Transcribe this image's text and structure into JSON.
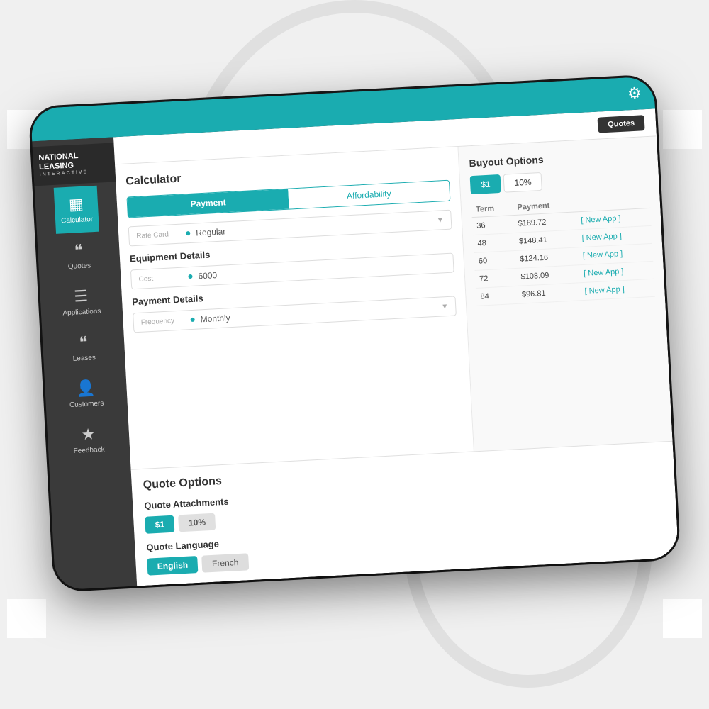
{
  "app": {
    "name": "National Leasing",
    "subtitle": "Interactive"
  },
  "topbar": {
    "settings_icon": "⚙"
  },
  "header": {
    "quotes_button": "Quotes"
  },
  "sidebar": {
    "items": [
      {
        "id": "calculator",
        "label": "Calculator",
        "icon": "▦",
        "active": true
      },
      {
        "id": "quotes",
        "label": "Quotes",
        "icon": "❝",
        "active": false
      },
      {
        "id": "applications",
        "label": "Applications",
        "icon": "☰",
        "active": false
      },
      {
        "id": "leases",
        "label": "Leases",
        "icon": "❝",
        "active": false
      },
      {
        "id": "customers",
        "label": "Customers",
        "icon": "👤",
        "active": false
      },
      {
        "id": "feedback",
        "label": "Feedback",
        "icon": "★",
        "active": false
      }
    ]
  },
  "calculator": {
    "title": "Calculator",
    "tabs": [
      {
        "id": "payment",
        "label": "Payment",
        "active": true
      },
      {
        "id": "affordability",
        "label": "Affordability",
        "active": false
      }
    ],
    "rate_card": {
      "label": "Rate Card",
      "value": "Regular"
    },
    "equipment": {
      "title": "Equipment Details",
      "cost_label": "Cost",
      "cost_value": "6000"
    },
    "payment_details": {
      "title": "Payment Details",
      "frequency_label": "Frequency",
      "frequency_value": "Monthly"
    }
  },
  "buyout_options": {
    "title": "Buyout Options",
    "tabs": [
      {
        "label": "$1",
        "active": true
      },
      {
        "label": "10%",
        "active": false
      }
    ],
    "columns": [
      "Term",
      "Payment",
      ""
    ],
    "rows": [
      {
        "term": "36",
        "payment": "$189.72",
        "action": "[ New App ]"
      },
      {
        "term": "48",
        "payment": "$148.41",
        "action": "[ New App ]"
      },
      {
        "term": "60",
        "payment": "$124.16",
        "action": "[ New App ]"
      },
      {
        "term": "72",
        "payment": "$108.09",
        "action": "[ New App ]"
      },
      {
        "term": "84",
        "payment": "$96.81",
        "action": "[ New App ]"
      }
    ]
  },
  "quote_options": {
    "title": "Quote Options",
    "attachments_title": "Quote Attachments",
    "attachments": [
      {
        "label": "$1",
        "active": true
      },
      {
        "label": "10%",
        "active": false
      }
    ],
    "language_title": "Quote Language",
    "languages": [
      {
        "label": "English",
        "active": true
      },
      {
        "label": "French",
        "active": false
      }
    ]
  }
}
